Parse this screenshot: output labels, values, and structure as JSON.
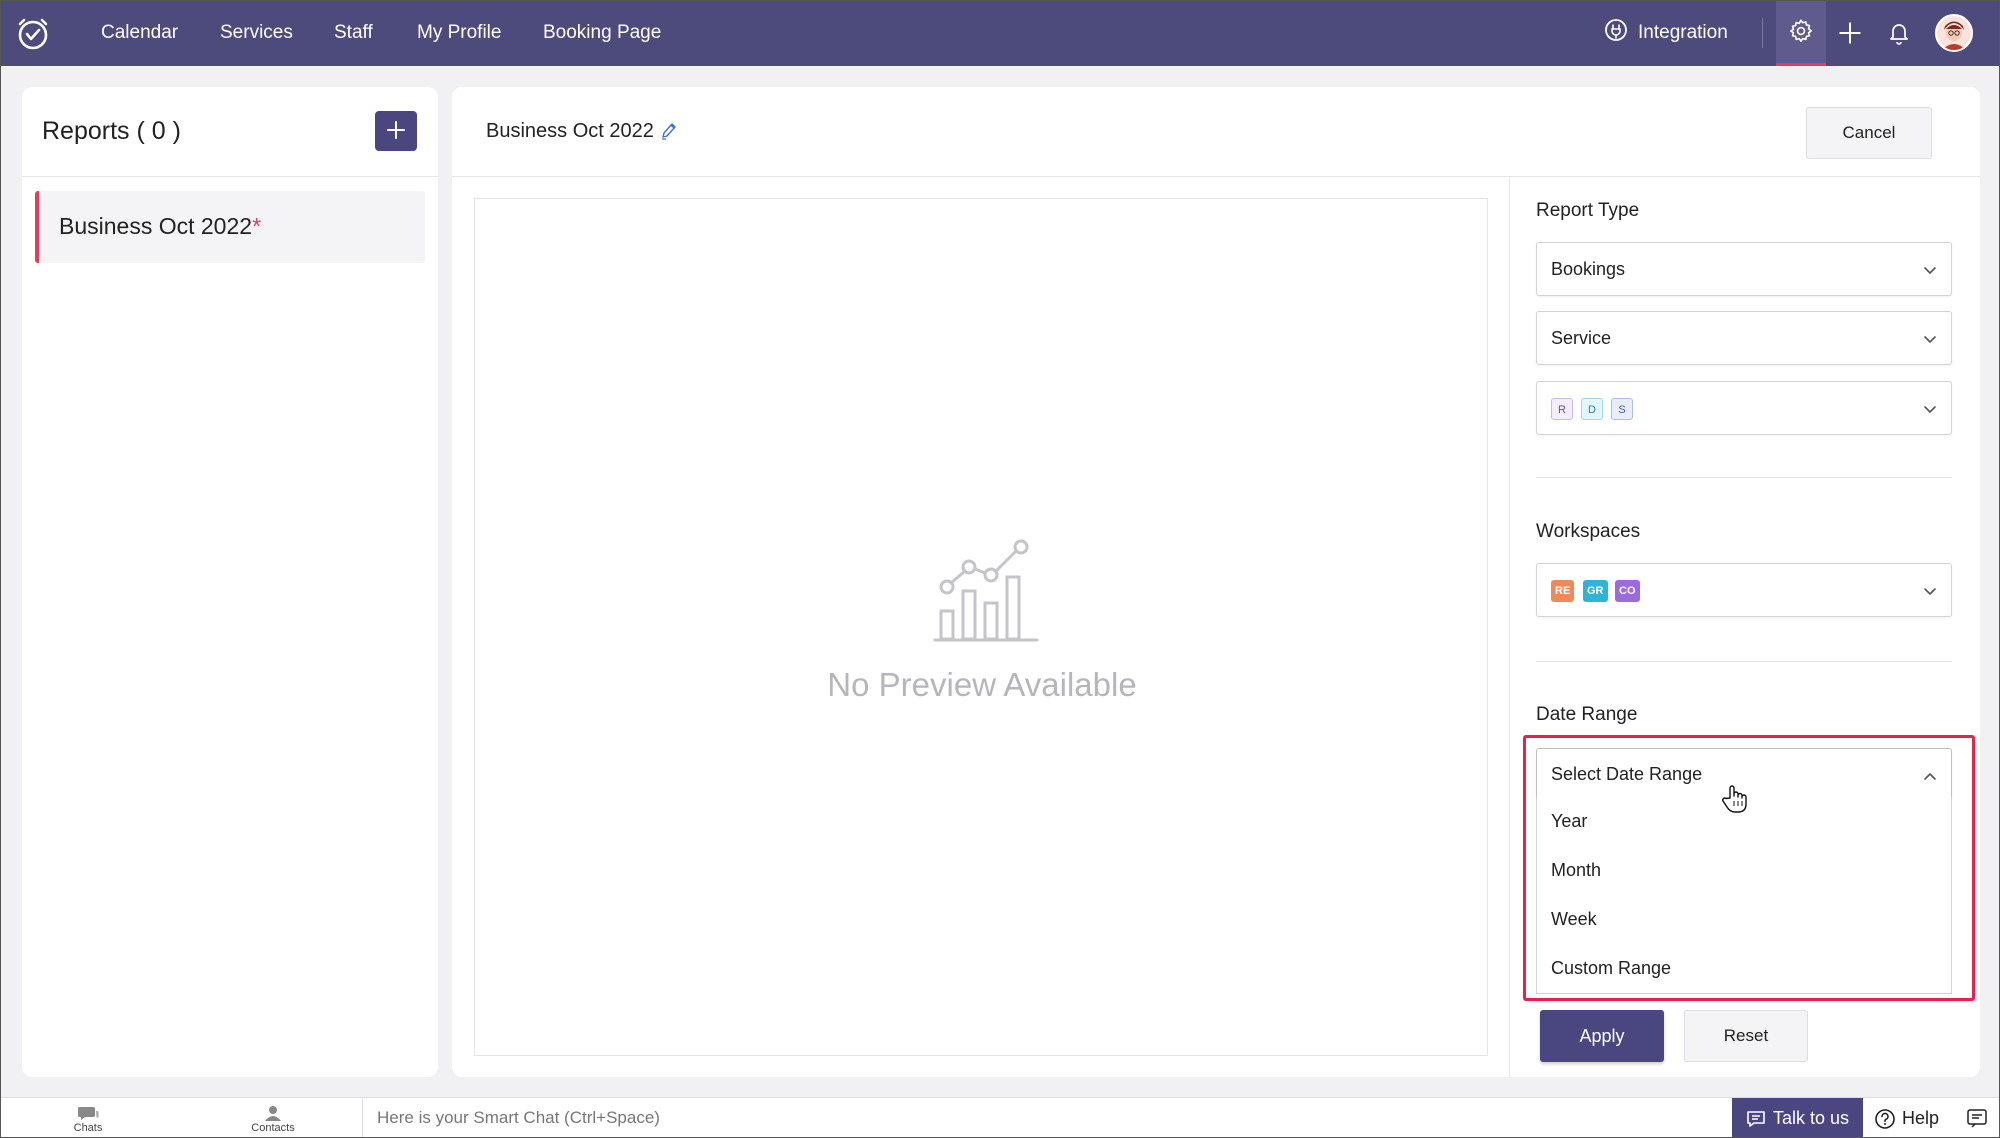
{
  "nav": {
    "items": [
      "Calendar",
      "Services",
      "Staff",
      "My Profile",
      "Booking Page"
    ],
    "integration_label": "Integration"
  },
  "left": {
    "title": "Reports ( 0 )",
    "report_item": "Business Oct 2022",
    "unsaved_mark": "*"
  },
  "main": {
    "title": "Business Oct 2022",
    "cancel_label": "Cancel",
    "preview_text": "No Preview Available"
  },
  "filters": {
    "report_type_label": "Report Type",
    "report_type_value": "Bookings",
    "group_by_value": "Service",
    "service_chips": [
      "R",
      "D",
      "S"
    ],
    "workspaces_label": "Workspaces",
    "workspace_chips": [
      "RE",
      "GR",
      "CO"
    ],
    "date_range_label": "Date Range",
    "date_range_placeholder": "Select Date Range",
    "date_range_options": [
      "Year",
      "Month",
      "Week",
      "Custom Range"
    ],
    "apply_label": "Apply",
    "reset_label": "Reset"
  },
  "bottom": {
    "chats_label": "Chats",
    "contacts_label": "Contacts",
    "smart_chat_placeholder": "Here is your Smart Chat (Ctrl+Space)",
    "talk_label": "Talk to us",
    "help_label": "Help"
  },
  "colors": {
    "topbar": "#4d4a7c",
    "primary_button": "#4a4680",
    "accent_red": "#e53b5c",
    "highlight_frame": "#e8204d"
  },
  "icons": {
    "logo": "calendar-clock-logo-icon",
    "integration": "plug-icon",
    "settings": "gear-icon",
    "add": "plus-icon",
    "notifications": "bell-icon",
    "edit": "pencil-icon",
    "preview": "bar-chart-icon",
    "chevron": "chevron-down-icon",
    "chats": "chat-bubble-icon",
    "contacts": "person-icon",
    "help": "question-circle-icon"
  }
}
